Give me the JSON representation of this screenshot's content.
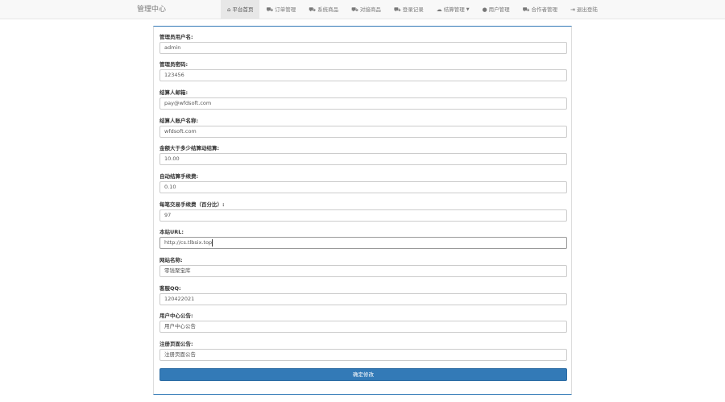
{
  "navbar": {
    "brand": "管理中心",
    "items": [
      {
        "label": "平台首页",
        "icon": "home-icon",
        "glyph": "⌂"
      },
      {
        "label": "订单管理",
        "icon": "cart-icon",
        "glyph": "⛟"
      },
      {
        "label": "系统商品",
        "icon": "cart-icon",
        "glyph": "⛟"
      },
      {
        "label": "对接商品",
        "icon": "cart-icon",
        "glyph": "⛟"
      },
      {
        "label": "登录记录",
        "icon": "cart-icon",
        "glyph": "⛟"
      },
      {
        "label": "结算管理",
        "icon": "cloud-icon",
        "glyph": "☁"
      },
      {
        "label": "用户管理",
        "icon": "user-icon",
        "glyph": "●"
      },
      {
        "label": "合作者管理",
        "icon": "cart-icon",
        "glyph": "⛟"
      },
      {
        "label": "退出登陆",
        "icon": "logout-icon",
        "glyph": "⇥"
      }
    ]
  },
  "form": {
    "fields": [
      {
        "label": "管理员用户名:",
        "value": "admin"
      },
      {
        "label": "管理员密码:",
        "value": "123456"
      },
      {
        "label": "结算人邮箱:",
        "value": "pay@wfdsoft.com"
      },
      {
        "label": "结算人账户名称:",
        "value": "wfdsoft.com"
      },
      {
        "label": "金额大于多少结算动结算:",
        "value": "10.00"
      },
      {
        "label": "自动结算手续费:",
        "value": "0.10"
      },
      {
        "label": "每笔交易手续费（百分比）:",
        "value": "97"
      },
      {
        "label": "本站URL:",
        "value": "http://cs.tlbsix.top"
      },
      {
        "label": "网站名称:",
        "value": "零钱聚宝库"
      },
      {
        "label": "客服QQ:",
        "value": "120422021"
      },
      {
        "label": "用户中心公告:",
        "value": "用户中心公告"
      },
      {
        "label": "注册页面公告:",
        "value": "注册页面公告"
      }
    ],
    "submit_label": "确定修改"
  }
}
